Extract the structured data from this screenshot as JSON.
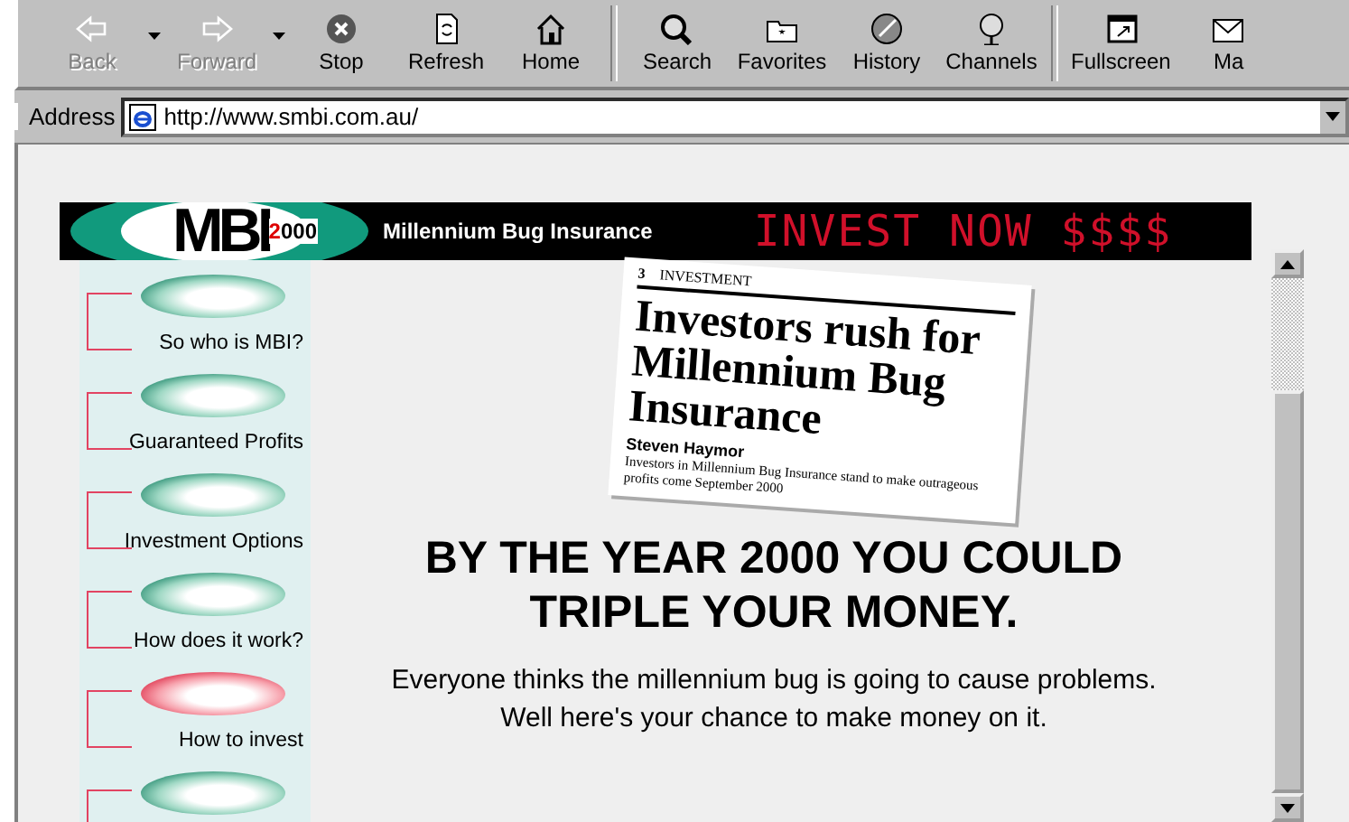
{
  "toolbar": {
    "groups": [
      [
        {
          "label": "Back",
          "disabled": true,
          "dropdown": true
        },
        {
          "label": "Forward",
          "disabled": true,
          "dropdown": true
        },
        {
          "label": "Stop",
          "disabled": false,
          "dropdown": false
        },
        {
          "label": "Refresh",
          "disabled": false,
          "dropdown": false
        },
        {
          "label": "Home",
          "disabled": false,
          "dropdown": false
        }
      ],
      [
        {
          "label": "Search",
          "disabled": false,
          "dropdown": false
        },
        {
          "label": "Favorites",
          "disabled": false,
          "dropdown": false
        },
        {
          "label": "History",
          "disabled": false,
          "dropdown": false
        },
        {
          "label": "Channels",
          "disabled": false,
          "dropdown": false
        }
      ],
      [
        {
          "label": "Fullscreen",
          "disabled": false,
          "dropdown": false
        },
        {
          "label": "Ma",
          "disabled": false,
          "dropdown": false
        }
      ]
    ]
  },
  "address_bar": {
    "label": "Address",
    "value": "http://www.smbi.com.au/"
  },
  "page": {
    "banner": {
      "logo": "MBI",
      "logo_year": "2000",
      "tagline": "Millennium Bug Insurance",
      "slogan": "INVEST NOW $$$$"
    },
    "nav": [
      {
        "label": "So who is MBI?",
        "selected": false
      },
      {
        "label": "Guaranteed Profits",
        "selected": false
      },
      {
        "label": "Investment Options",
        "selected": false
      },
      {
        "label": "How does it work?",
        "selected": false
      },
      {
        "label": "How to invest",
        "selected": true
      },
      {
        "selected": false
      }
    ],
    "clipping": {
      "page_number": "3",
      "section": "INVESTMENT",
      "headline": "Investors rush for Millennium Bug Insurance",
      "byline": "Steven Haymor",
      "body": "Investors in Millennium Bug Insurance stand to make outrageous profits come September 2000"
    },
    "headline": [
      "BY THE YEAR 2000 YOU COULD",
      "TRIPLE YOUR MONEY."
    ],
    "intro": [
      "Everyone thinks the millennium bug is going to cause problems.",
      "Well here's your chance to make money on it."
    ]
  }
}
